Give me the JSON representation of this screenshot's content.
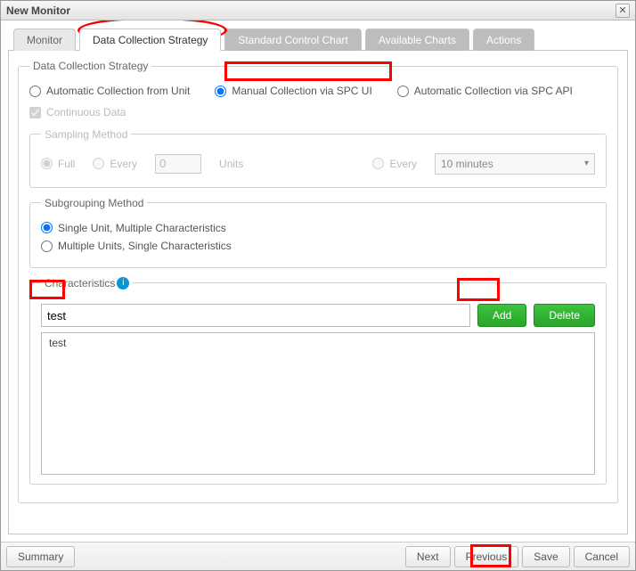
{
  "window": {
    "title": "New Monitor"
  },
  "tabs": {
    "monitor": "Monitor",
    "data_collection": "Data Collection Strategy",
    "standard_chart": "Standard Control Chart",
    "available_charts": "Available Charts",
    "actions": "Actions"
  },
  "group": {
    "title": "Data Collection Strategy",
    "opt_auto_unit": "Automatic Collection from Unit",
    "opt_manual_spc": "Manual Collection via SPC UI",
    "opt_auto_api": "Automatic Collection via SPC API",
    "continuous": "Continuous Data"
  },
  "sampling": {
    "title": "Sampling Method",
    "full": "Full",
    "every_units_label": "Every",
    "every_units_value": "0",
    "units_suffix": "Units",
    "every_time_label": "Every",
    "interval_selected": "10 minutes"
  },
  "subgrouping": {
    "title": "Subgrouping Method",
    "single_multi": "Single Unit, Multiple Characteristics",
    "multi_single": "Multiple Units, Single Characteristics"
  },
  "characteristics": {
    "title": "Characteristics",
    "input_value": "test",
    "add": "Add",
    "delete": "Delete",
    "items": [
      "test"
    ]
  },
  "footer": {
    "summary": "Summary",
    "next": "Next",
    "previous": "Previous",
    "save": "Save",
    "cancel": "Cancel"
  }
}
